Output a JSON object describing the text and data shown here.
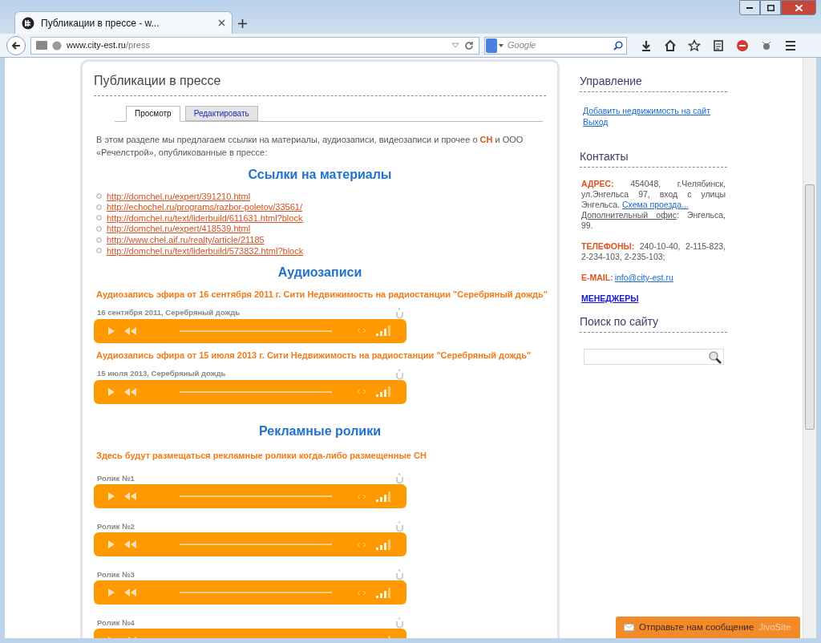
{
  "browser": {
    "tab_title": "Публикации в прессе - w...",
    "url_host": "www.city-est.ru",
    "url_path": "/press",
    "search_placeholder": "Google"
  },
  "page": {
    "title": "Публикации в прессе",
    "tabs": [
      {
        "label": "Просмотр",
        "selected": true
      },
      {
        "label": "Редактировать",
        "selected": false
      }
    ],
    "intro": "В этом разделе мы предлагаем ссылки на материалы, аудиозаписи, видеозаписи и прочее о **СН** и ООО «Речелстрой», опубликованные в прессе:",
    "links_heading": "Ссылки на материалы",
    "links": [
      "http://domchel.ru/expert/391210.html",
      "http://echochel.ru/programs/razbor-poletov/33561/",
      "http://domchel.ru/text/liderbuild/611631.html?block",
      "http://domchel.ru/expert/418539.html",
      "http://www.chel.aif.ru/realty/article/21185",
      "http://domchel.ru/text/liderbuild/573832.html?block"
    ],
    "audio_heading": "Аудиозаписи",
    "audio": [
      {
        "title": "Аудиозапись эфира от 16 сентября 2011 г. Сити Недвижимость на радиостанции \"Серебряный дождь\"",
        "caption": "16 сентября 2011, Серебряный дождь"
      },
      {
        "title": "Аудиозапись эфира от 15 июля 2013 г. Сити Недвижимость на радиостанции \"Серебряный дождь\"",
        "caption": "15 июля 2013, Серебряный дождь"
      }
    ],
    "ads_heading": "Рекламные ролики",
    "ads_note": "Здесь будут размещаться рекламные ролики когда-либо размещенные СН",
    "ads": [
      {
        "caption": "Ролик №1"
      },
      {
        "caption": "Ролик №2"
      },
      {
        "caption": "Ролик №3"
      },
      {
        "caption": "Ролик №4"
      }
    ]
  },
  "sidebar": {
    "management": {
      "heading": "Управление",
      "links": [
        "Добавить недвижимость на сайт",
        "Выход"
      ]
    },
    "contacts": {
      "heading": "Контакты",
      "address_label": "АДРЕС:",
      "address": " 454048, г.Челябинск, ул.Энгельса 97, вход с улицы Энгельса. ",
      "map_link": "Схема проезда...",
      "office_label": "Дополнительный офис",
      "office": ": Энгельса, 99.",
      "phones_label": "ТЕЛЕФОНЫ:",
      "phones": " 240-10-40, 2-115-823, 2-234-103, 2-235-103;",
      "email_label": "E-MAIL:",
      "email": "info@city-est.ru",
      "managers": "МЕНЕДЖЕРЫ"
    },
    "search": {
      "heading": "Поиск по сайту"
    }
  },
  "chat": {
    "label": "Отправьте нам сообщение",
    "brand": "JivoSite"
  }
}
